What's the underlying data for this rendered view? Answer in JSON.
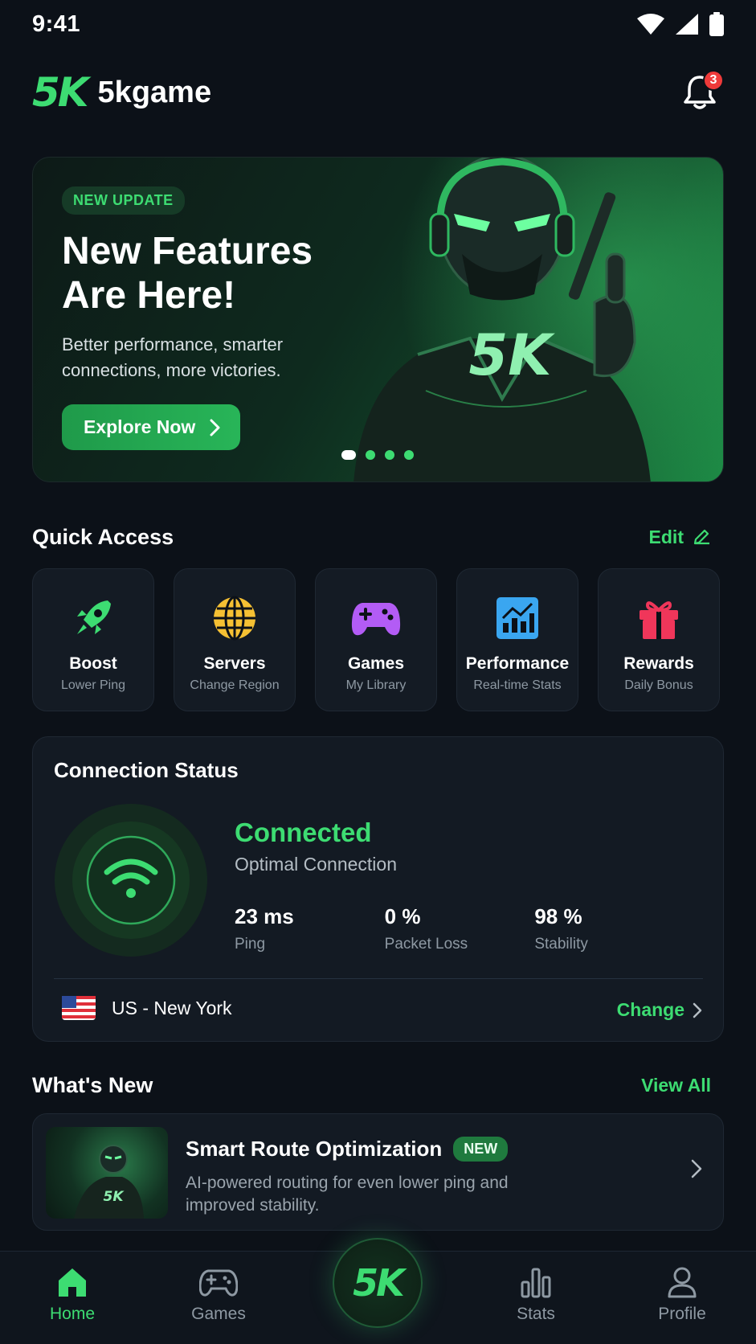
{
  "status_bar": {
    "time": "9:41"
  },
  "header": {
    "logo_text": "5K",
    "app_name": "5kgame",
    "notification_count": "3"
  },
  "hero": {
    "tag": "NEW UPDATE",
    "title_line1": "New Features",
    "title_line2": "Are Here!",
    "subtitle": "Better performance, smarter connections, more victories.",
    "cta_label": "Explore Now",
    "figure_chest_text": "5K",
    "slide_count": 4,
    "active_slide": 1
  },
  "quick_access": {
    "title": "Quick Access",
    "edit_label": "Edit",
    "items": [
      {
        "label": "Boost",
        "sub": "Lower Ping",
        "icon": "rocket-icon",
        "color": "#3ddc72"
      },
      {
        "label": "Servers",
        "sub": "Change Region",
        "icon": "globe-icon",
        "color": "#f5c033"
      },
      {
        "label": "Games",
        "sub": "My Library",
        "icon": "gamepad-icon",
        "color": "#b35cf5"
      },
      {
        "label": "Performance",
        "sub": "Real-time Stats",
        "icon": "chart-icon",
        "color": "#3aa6f0"
      },
      {
        "label": "Rewards",
        "sub": "Daily Bonus",
        "icon": "gift-icon",
        "color": "#f0365a"
      }
    ]
  },
  "connection": {
    "title": "Connection Status",
    "state": "Connected",
    "quality": "Optimal Connection",
    "metrics": [
      {
        "value": "23 ms",
        "label": "Ping"
      },
      {
        "value": "0 %",
        "label": "Packet Loss"
      },
      {
        "value": "98 %",
        "label": "Stability"
      }
    ],
    "location": "US - New York",
    "change_label": "Change"
  },
  "whats_new": {
    "title": "What's New",
    "view_all_label": "View All",
    "item": {
      "title": "Smart Route Optimization",
      "tag": "NEW",
      "description": "AI-powered routing for even lower ping and improved stability.",
      "thumb_text": "5K"
    }
  },
  "bottom_nav": {
    "items": [
      {
        "label": "Home",
        "icon": "home-icon",
        "active": true
      },
      {
        "label": "Games",
        "icon": "gamepad-icon",
        "active": false
      },
      {
        "label": "Stats",
        "icon": "bar-chart-icon",
        "active": false
      },
      {
        "label": "Profile",
        "icon": "user-icon",
        "active": false
      }
    ],
    "center_logo": "5K"
  },
  "colors": {
    "accent": "#3ddc72",
    "background": "#0c1118",
    "card": "#131a23",
    "badge": "#ef3a3a"
  }
}
